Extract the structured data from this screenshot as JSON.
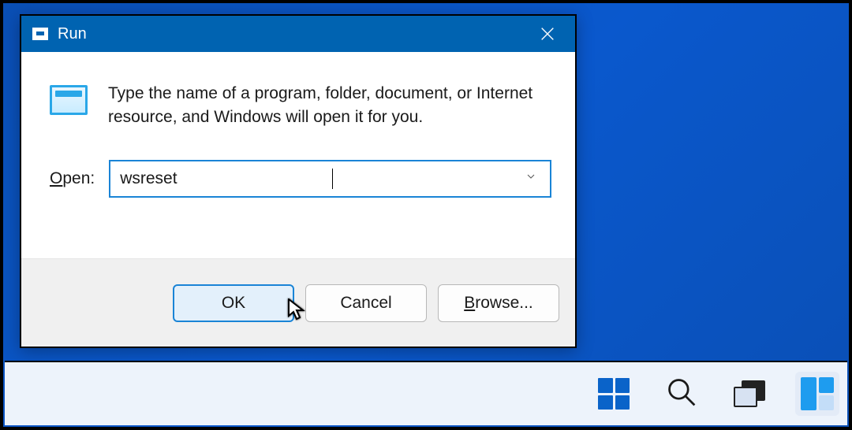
{
  "window": {
    "title": "Run",
    "description": "Type the name of a program, folder, document, or Internet resource, and Windows will open it for you.",
    "open_label_pre": "O",
    "open_label_post": "pen:",
    "input_value": "wsreset",
    "buttons": {
      "ok": "OK",
      "cancel": "Cancel",
      "browse_pre": "B",
      "browse_post": "rowse..."
    }
  },
  "taskbar": {
    "start": "start-menu",
    "search": "search",
    "taskview": "task-view",
    "widgets": "widgets"
  }
}
